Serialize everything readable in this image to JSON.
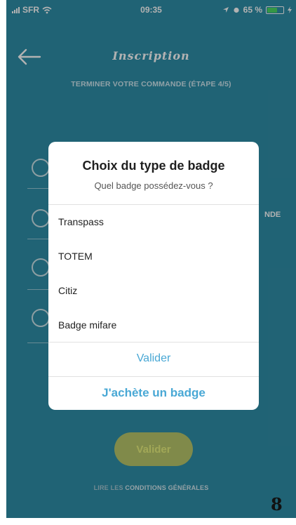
{
  "status_bar": {
    "carrier": "SFR",
    "time": "09:35",
    "battery": "65 %",
    "battery_level": 0.65,
    "icons": [
      "signal-icon",
      "wifi-icon",
      "location-icon",
      "alarm-icon",
      "battery-icon",
      "charging-icon"
    ]
  },
  "header": {
    "title": "Inscription",
    "subtitle": "TERMINER VOTRE COMMANDE (ÉTAPE 4/5)"
  },
  "background": {
    "side_text": "NDE",
    "bottom_button": "Valider",
    "conditions_prefix": "LIRE LES ",
    "conditions_link": "CONDITIONS GÉNÉRALES"
  },
  "dialog": {
    "title": "Choix du type de badge",
    "subtitle": "Quel badge possédez-vous ?",
    "options": [
      "Transpass",
      "TOTEM",
      "Citiz",
      "Badge mifare"
    ],
    "validate_label": "Valider",
    "buy_label": "J'achète un badge"
  },
  "page_number": "8",
  "colors": {
    "screen_bg": "#2f8ea8",
    "accent": "#49a8d5",
    "button_bg": "#b8c66a",
    "button_text": "#e7f07d"
  }
}
